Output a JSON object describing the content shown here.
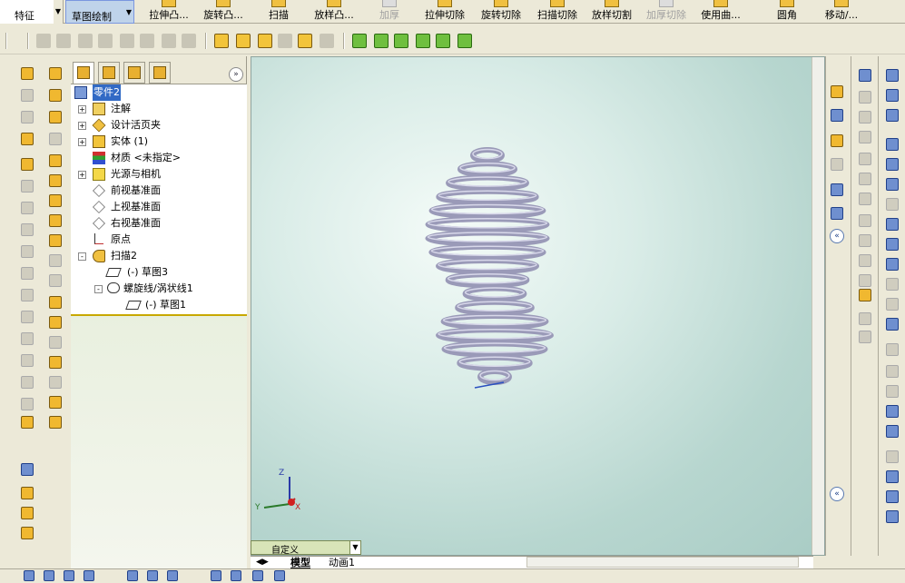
{
  "command_manager": {
    "feature_label": "特征",
    "sketch_label": "草图绘制",
    "commands": [
      {
        "label": "拉伸凸...",
        "enabled": true
      },
      {
        "label": "旋转凸...",
        "enabled": true
      },
      {
        "label": "扫描",
        "enabled": true
      },
      {
        "label": "放样凸...",
        "enabled": true
      },
      {
        "label": "加厚",
        "enabled": false
      },
      {
        "label": "拉伸切除",
        "enabled": true
      },
      {
        "label": "旋转切除",
        "enabled": true
      },
      {
        "label": "扫描切除",
        "enabled": true
      },
      {
        "label": "放样切割",
        "enabled": true
      },
      {
        "label": "加厚切除",
        "enabled": false
      },
      {
        "label": "使用曲...",
        "enabled": true
      },
      {
        "label": "圆角",
        "enabled": true
      },
      {
        "label": "移动/...",
        "enabled": true
      }
    ]
  },
  "feature_tree": {
    "root": "零件2",
    "nodes": [
      {
        "label": "注解",
        "expander": "+"
      },
      {
        "label": "设计活页夹",
        "expander": "+"
      },
      {
        "label": "实体 (1)",
        "expander": "+"
      },
      {
        "label": "材质 <未指定>",
        "expander": ""
      },
      {
        "label": "光源与相机",
        "expander": "+"
      },
      {
        "label": "前视基准面",
        "expander": ""
      },
      {
        "label": "上视基准面",
        "expander": ""
      },
      {
        "label": "右视基准面",
        "expander": ""
      },
      {
        "label": "原点",
        "expander": ""
      },
      {
        "label": "扫描2",
        "expander": "-"
      },
      {
        "label": "(-) 草图3",
        "expander": ""
      },
      {
        "label": "螺旋线/涡状线1",
        "expander": "-"
      },
      {
        "label": "(-) 草图1",
        "expander": ""
      }
    ]
  },
  "viewport": {
    "view_dropdown": "自定义",
    "tabs": [
      "模型",
      "动画1"
    ],
    "triad": {
      "x": "X",
      "y": "Y",
      "z": "Z"
    }
  },
  "colors": {
    "spring": "#9a9ab8",
    "selection": "#316ac5",
    "rollback_bar": "#c8a800"
  }
}
